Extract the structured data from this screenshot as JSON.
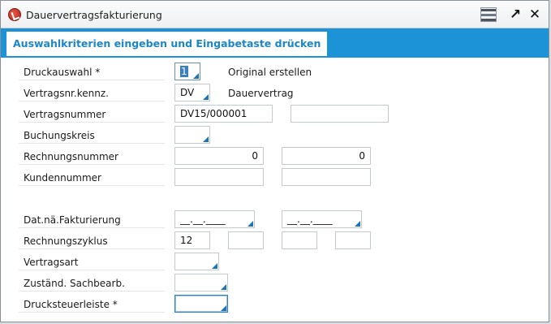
{
  "window": {
    "title": "Dauervertragsfakturierung",
    "icons": [
      "app-logo-icon",
      "settings-icon",
      "expand-icon",
      "close-icon"
    ],
    "expand_glyph": "↗",
    "close_glyph": "✕"
  },
  "header": {
    "title": "Auswahlkriterien eingeben und Eingabetaste drücken",
    "band_color": "#1d93d7"
  },
  "form": {
    "druckauswahl": {
      "label": "Druckauswahl *",
      "value": "1",
      "description": "Original erstellen"
    },
    "vertragsnr_kennz": {
      "label": "Vertragsnr.kennz.",
      "value": "DV",
      "description": "Dauervertrag"
    },
    "vertragsnummer": {
      "label": "Vertragsnummer",
      "from": "DV15/000001",
      "to": ""
    },
    "buchungskreis": {
      "label": "Buchungskreis",
      "value": ""
    },
    "rechnungsnummer": {
      "label": "Rechnungsnummer",
      "from": "0",
      "to": "0"
    },
    "kundennummer": {
      "label": "Kundennummer",
      "from": "",
      "to": ""
    },
    "dat_fakturierung": {
      "label": "Dat.nä.Fakturierung",
      "from": "__.__.____",
      "to": "__.__.____"
    },
    "rechnungszyklus": {
      "label": "Rechnungszyklus",
      "values": [
        "12",
        "",
        "",
        ""
      ]
    },
    "vertragsart": {
      "label": "Vertragsart",
      "value": ""
    },
    "sachbearb": {
      "label": "Zuständ. Sachbearb.",
      "value": ""
    },
    "drucksteuerleiste": {
      "label": "Drucksteuerleiste *",
      "value": ""
    }
  },
  "colors": {
    "accent": "#1d93d7",
    "dropdown_marker": "#1b74b8"
  }
}
